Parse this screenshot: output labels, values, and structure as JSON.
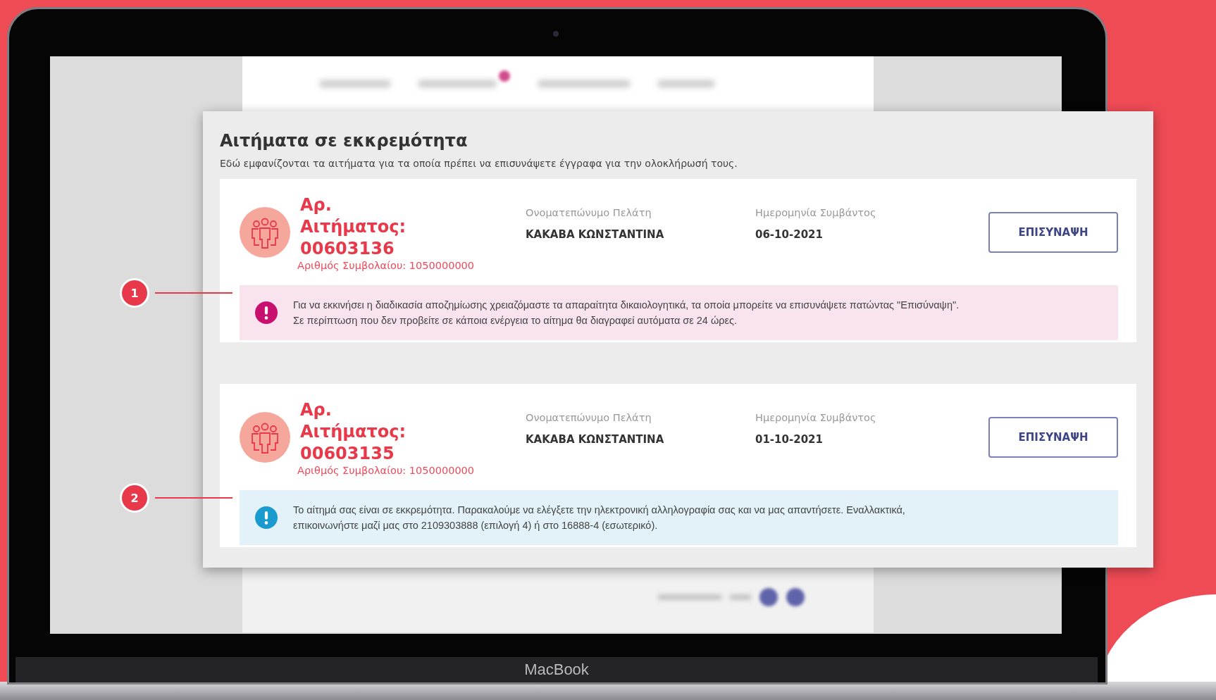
{
  "modal": {
    "title": "Αιτήματα σε εκκρεμότητα",
    "subtitle": "Εδώ εμφανίζονται τα αιτήματα για τα οποία πρέπει να επισυνάψετε έγγραφα για την ολοκλήρωσή τους.",
    "requests": [
      {
        "request": "Αρ. Αιτήματος: 00603136",
        "contract": "Αριθμός Συμβολαίου: 1050000000",
        "customer_label": "Ονοματεπώνυμο Πελάτη",
        "customer_name": "ΚΑΚΑΒΑ ΚΩΝΣΤΑΝΤΙΝΑ",
        "date_label": "Ημερομηνία Συμβάντος",
        "date": "06-10-2021",
        "button": "ΕΠΙΣΥΝΑΨΗ",
        "alert": {
          "kind": "warning",
          "lines": [
            "Για να εκκινήσει η διαδικασία αποζημίωσης χρειαζόμαστε τα απαραίτητα δικαιολογητικά, τα οποία μπορείτε να επισυνάψετε πατώντας \"Επισύναψη\".",
            "Σε περίπτωση που δεν προβείτε σε κάποια ενέργεια το αίτημα θα διαγραφεί αυτόματα σε 24 ώρες."
          ]
        },
        "callout": "1"
      },
      {
        "request": "Αρ. Αιτήματος: 00603135",
        "contract": "Αριθμός Συμβολαίου: 1050000000",
        "customer_label": "Ονοματεπώνυμο Πελάτη",
        "customer_name": "ΚΑΚΑΒΑ ΚΩΝΣΤΑΝΤΙΝΑ",
        "date_label": "Ημερομηνία Συμβάντος",
        "date": "01-10-2021",
        "button": "ΕΠΙΣΥΝΑΨΗ",
        "alert": {
          "kind": "info",
          "lines": [
            "Το αίτημά σας είναι σε εκκρεμότητα. Παρακαλούμε να ελέγξετε την ηλεκτρονική αλληλογραφία σας και να μας απαντήσετε. Εναλλακτικά,",
            "επικοινωνήστε μαζί μας στο 2109303888 (επιλογή 4) ή στο 16888-4 (εσωτερικό)."
          ]
        },
        "callout": "2"
      }
    ]
  },
  "device_label": "MacBook"
}
